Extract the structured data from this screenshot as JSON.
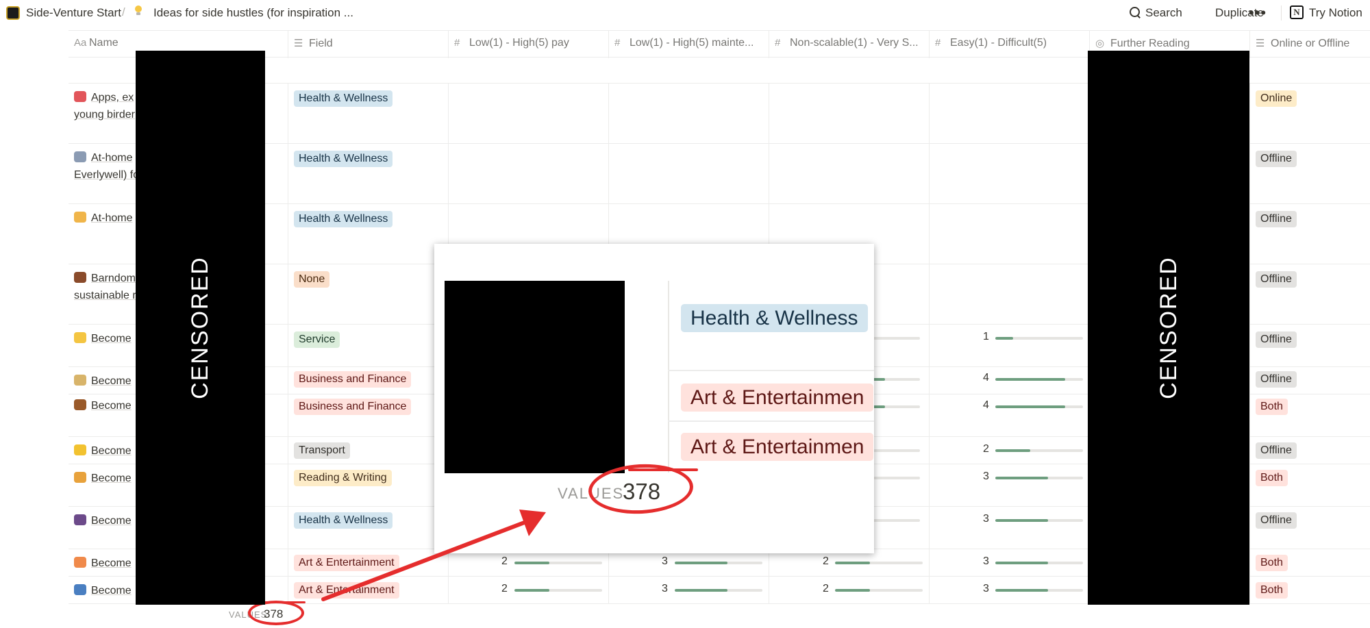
{
  "topbar": {
    "workspace": "Side-Venture Start",
    "separator": "/",
    "page_title": "Ideas for side hustles (for inspiration ...",
    "search_label": "Search",
    "duplicate_label": "Duplicate",
    "more_label": "•••",
    "try_notion_label": "Try Notion",
    "notion_logo_letter": "N"
  },
  "columns": [
    {
      "icon": "Aa",
      "label": "Name"
    },
    {
      "icon": "☰",
      "label": "Field"
    },
    {
      "icon": "#",
      "label": "Low(1) - High(5) pay"
    },
    {
      "icon": "#",
      "label": "Low(1) - High(5) mainte..."
    },
    {
      "icon": "#",
      "label": "Non-scalable(1) - Very S..."
    },
    {
      "icon": "#",
      "label": "Easy(1) - Difficult(5)"
    },
    {
      "icon": "◎",
      "label": "Further Reading"
    },
    {
      "icon": "☰",
      "label": "Online or Offline"
    }
  ],
  "rows": [
    {
      "name1": "Apps, ex",
      "name2": "young birder",
      "field": "Health & Wellness",
      "mode": "Online"
    },
    {
      "name1": "At-home",
      "name2": "Everlywell) fo",
      "field": "Health & Wellness",
      "mode": "Offline"
    },
    {
      "name1": "At-home",
      "name2": "",
      "field": "Health & Wellness",
      "mode": "Offline"
    },
    {
      "name1": "Barndom",
      "name2": "sustainable r",
      "field": "None",
      "mode": "Offline"
    },
    {
      "name1": "Become",
      "field": "Service",
      "easy": "1",
      "mode": "Offline"
    },
    {
      "name1": "Become",
      "field": "Business and Finance",
      "easy": "4",
      "mode": "Offline"
    },
    {
      "name1": "Become",
      "field": "Business and Finance",
      "easy": "4",
      "mode": "Both"
    },
    {
      "name1": "Become",
      "field": "Transport",
      "easy": "2",
      "mode": "Offline"
    },
    {
      "name1": "Become",
      "field": "Reading & Writing",
      "easy": "3",
      "mode": "Both"
    },
    {
      "name1": "Become",
      "field": "Health & Wellness",
      "easy": "3",
      "mode": "Offline"
    },
    {
      "name1": "Become",
      "field": "Art & Entertainment",
      "pay": "2",
      "maint": "3",
      "scal": "2",
      "easy": "3",
      "mode": "Both"
    },
    {
      "name1": "Become",
      "field": "Art & Entertainment",
      "pay": "2",
      "maint": "3",
      "scal": "2",
      "easy": "3",
      "mode": "Both"
    }
  ],
  "footer": {
    "values_label": "VALUES",
    "values_count": "378"
  },
  "censor_text": "CENSORED",
  "zoom": {
    "tags": [
      "Health & Wellness",
      "Art & Entertainmen",
      "Art & Entertainmen"
    ],
    "values_label": "VALUES",
    "values_count": "378"
  },
  "colors": {
    "annotation_red": "#e52d2d",
    "bar_fill": "#6e9e7f"
  }
}
